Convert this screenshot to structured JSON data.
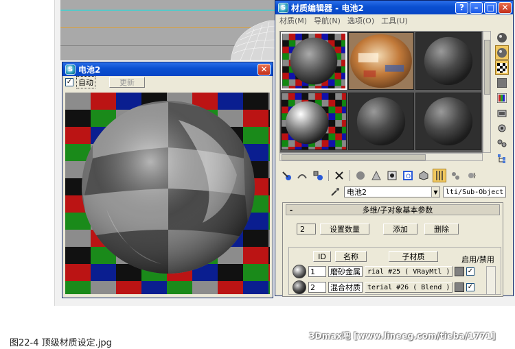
{
  "preview_window": {
    "title": "电池2",
    "auto_label": "自动",
    "auto_checked": true,
    "update_label": "更新",
    "close_glyph": "✕"
  },
  "material_editor": {
    "title": "材质编辑器 - 电池2",
    "menu": [
      "材质(M)",
      "导航(N)",
      "选项(O)",
      "工具(U)"
    ],
    "material_name": "电池2",
    "material_type": "lti/Sub-Object",
    "rollout": {
      "title": "多维/子对象基本参数",
      "count": "2",
      "set_count_label": "设置数量",
      "add_label": "添加",
      "delete_label": "删除",
      "col_id": "ID",
      "col_name": "名称",
      "col_submaterial": "子材质",
      "col_enable": "启用/禁用",
      "rows": [
        {
          "id": "1",
          "name": "磨砂金属",
          "submaterial": "rial #25  ( VRayMtl )",
          "checked": "✓"
        },
        {
          "id": "2",
          "name": "混合材质",
          "submaterial": "terial #26  ( Blend )",
          "checked": "✓"
        }
      ]
    }
  },
  "caption": "图22-4 顶级材质设定.jpg",
  "watermark": "3Dmax吧 [www.lineeg.com/tieba/1771]",
  "icons": [
    "app-icon",
    "close-icon",
    "minimize-icon",
    "maximize-icon",
    "help-icon",
    "sample-type-icon",
    "backlight-icon",
    "checker-background-icon",
    "options-icon",
    "pick-icon",
    "delete-icon"
  ]
}
